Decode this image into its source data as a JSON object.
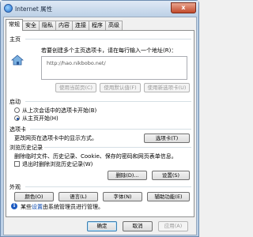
{
  "window": {
    "title": "Internet 属性",
    "close_label": "x"
  },
  "tabs": [
    "常规",
    "安全",
    "隐私",
    "内容",
    "连接",
    "程序",
    "高级"
  ],
  "home": {
    "heading": "主页",
    "description": "若要创建多个主页选项卡，请在每行输入一个地址(R)：",
    "url": "http://hao.nikbobo.net/",
    "buttons": [
      "使用当前页(C)",
      "使用默认值(F)",
      "使用新选项卡(U)"
    ]
  },
  "startup": {
    "heading": "启动",
    "options": [
      "从上次会话中的选项卡开始(B)",
      "从主页开始(H)"
    ],
    "selected": 1
  },
  "tabs_section": {
    "heading": "选项卡",
    "description": "更改网页在选项卡中的显示方式。",
    "button": "选项卡(T)"
  },
  "history": {
    "heading": "浏览历史记录",
    "description": "删除临时文件、历史记录、Cookie、保存的密码和网页表单信息。",
    "checkbox": "退出时删除浏览历史记录(W)",
    "delete_button": "删除(D)...",
    "settings_button": "设置(S)"
  },
  "appearance": {
    "heading": "外观",
    "buttons": [
      "颜色(O)",
      "语言(L)",
      "字体(N)",
      "辅助功能(E)"
    ]
  },
  "notice": {
    "prefix": "某些",
    "link": "设置",
    "suffix": "由系统管理员进行管理。"
  },
  "footer": {
    "ok": "确定",
    "cancel": "取消",
    "apply": "应用(A)"
  }
}
